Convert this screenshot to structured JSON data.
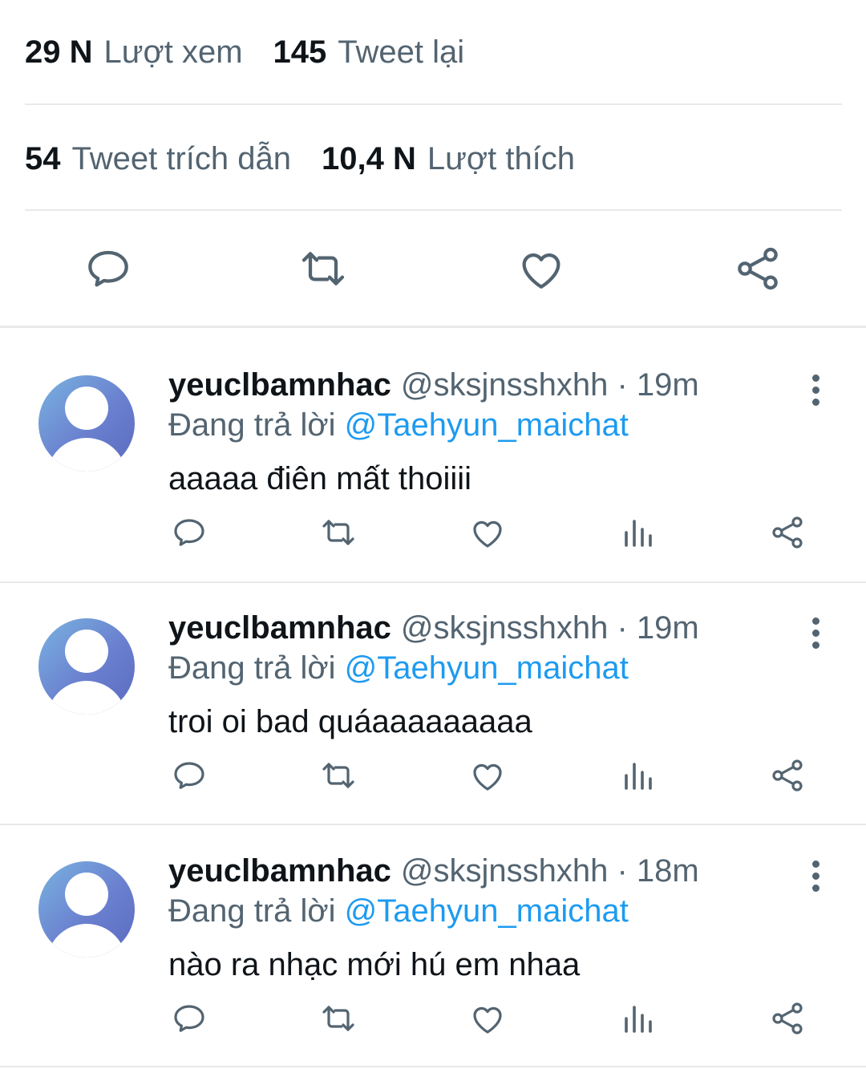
{
  "stats": {
    "views_count": "29 N",
    "views_label": "Lượt xem",
    "retweets_count": "145",
    "retweets_label": "Tweet lại",
    "quotes_count": "54",
    "quotes_label": "Tweet trích dẫn",
    "likes_count": "10,4 N",
    "likes_label": "Lượt thích"
  },
  "main_actions": [
    "reply-icon",
    "retweet-icon",
    "like-icon",
    "share-icon"
  ],
  "replies": [
    {
      "name": "yeuclbamnhac",
      "handle_time": "@sksjnsshxhh · 19m",
      "replying_prefix": "Đang trả lời",
      "replying_to": "@Taehyun_maichat",
      "text": "aaaaa điên mất thoiiii"
    },
    {
      "name": "yeuclbamnhac",
      "handle_time": "@sksjnsshxhh · 19m",
      "replying_prefix": "Đang trả lời",
      "replying_to": "@Taehyun_maichat",
      "text": "troi oi bad quáaaaaaaaaa"
    },
    {
      "name": "yeuclbamnhac",
      "handle_time": "@sksjnsshxhh · 18m",
      "replying_prefix": "Đang trả lời",
      "replying_to": "@Taehyun_maichat",
      "text": "nào ra nhạc mới hú em nhaa"
    }
  ],
  "colors": {
    "text_primary": "#0f1419",
    "text_secondary": "#536471",
    "link": "#1d9bf0",
    "divider": "#e7e9ea"
  }
}
